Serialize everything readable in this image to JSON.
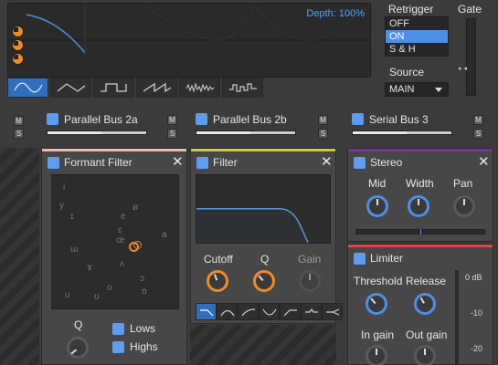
{
  "lfo": {
    "depth_label": "Depth: 100%",
    "waveforms": [
      "sine",
      "triangle",
      "square",
      "saw",
      "noise",
      "random-steps"
    ],
    "active_waveform": 0
  },
  "retrigger": {
    "label": "Retrigger",
    "options": [
      "OFF",
      "ON",
      "S & H"
    ],
    "selected": "ON"
  },
  "source": {
    "label": "Source",
    "value": "MAIN"
  },
  "gate": {
    "label": "Gate"
  },
  "buses": [
    {
      "label": "Parallel Bus 2a",
      "level": 0.55,
      "m": "M",
      "s": "S"
    },
    {
      "label": "Parallel Bus 2b",
      "level": 0.55,
      "m": "M",
      "s": "S"
    },
    {
      "label": "Serial Bus 3",
      "level": 0.55,
      "m": "M",
      "s": "S"
    }
  ],
  "formant": {
    "title": "Formant Filter",
    "accent": "#f0b9a6",
    "vowels": [
      "i",
      "y",
      "ɪ",
      "e",
      "ø",
      "ɛ",
      "œ",
      "a",
      "ɯ",
      "ʌ",
      "ɤ",
      "ɔ",
      "o",
      "u",
      "ʊ",
      "ɒ"
    ],
    "q_label": "Q",
    "lows_label": "Lows",
    "highs_label": "Highs"
  },
  "filter": {
    "title": "Filter",
    "accent": "#c7cc3e",
    "cutoff_label": "Cutoff",
    "q_label": "Q",
    "gain_label": "Gain",
    "shapes": [
      "lowpass",
      "bandpass-low",
      "highshelf",
      "notch",
      "highpass",
      "peak",
      "lowshelf"
    ],
    "active_shape": 0
  },
  "stereo": {
    "title": "Stereo",
    "accent": "#7a2fa8",
    "mid_label": "Mid",
    "width_label": "Width",
    "pan_label": "Pan"
  },
  "limiter": {
    "title": "Limiter",
    "accent": "#e0444a",
    "threshold_label": "Threshold",
    "release_label": "Release",
    "in_gain_label": "In gain",
    "out_gain_label": "Out gain",
    "meter_ticks": [
      "0 dB",
      "-10",
      "-20"
    ]
  },
  "colors": {
    "accent_blue": "#4c8fe8",
    "knob_orange": "#f08a24"
  }
}
